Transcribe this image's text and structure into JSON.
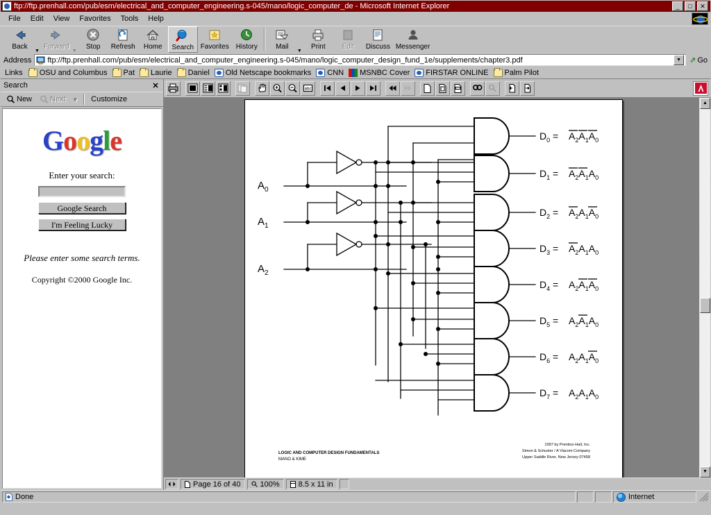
{
  "window": {
    "title": "ftp://ftp.prenhall.com/pub/esm/electrical_and_computer_engineering.s-045/mano/logic_computer_de - Microsoft Internet Explorer",
    "minimize_label": "_",
    "maximize_label": "□",
    "close_label": "✕",
    "app_icon": "ie-document-icon"
  },
  "menu": {
    "items": [
      "File",
      "Edit",
      "View",
      "Favorites",
      "Tools",
      "Help"
    ]
  },
  "toolbar": {
    "buttons": [
      {
        "label": "Back",
        "icon": "back-arrow-icon",
        "disabled": false,
        "dropdown": true,
        "selected": false
      },
      {
        "label": "Forward",
        "icon": "forward-arrow-icon",
        "disabled": true,
        "dropdown": true,
        "selected": false
      },
      {
        "label": "Stop",
        "icon": "stop-icon",
        "disabled": false,
        "dropdown": false,
        "selected": false
      },
      {
        "label": "Refresh",
        "icon": "refresh-icon",
        "disabled": false,
        "dropdown": false,
        "selected": false
      },
      {
        "label": "Home",
        "icon": "home-icon",
        "disabled": false,
        "dropdown": false,
        "selected": false
      },
      {
        "label": "Search",
        "icon": "search-icon",
        "disabled": false,
        "dropdown": false,
        "selected": true
      },
      {
        "label": "Favorites",
        "icon": "favorites-icon",
        "disabled": false,
        "dropdown": false,
        "selected": false
      },
      {
        "label": "History",
        "icon": "history-icon",
        "disabled": false,
        "dropdown": false,
        "selected": false
      },
      {
        "label": "Mail",
        "icon": "mail-icon",
        "disabled": false,
        "dropdown": true,
        "selected": false
      },
      {
        "label": "Print",
        "icon": "print-icon",
        "disabled": false,
        "dropdown": false,
        "selected": false
      },
      {
        "label": "Edit",
        "icon": "edit-icon",
        "disabled": true,
        "dropdown": false,
        "selected": false
      },
      {
        "label": "Discuss",
        "icon": "discuss-icon",
        "disabled": false,
        "dropdown": false,
        "selected": false
      },
      {
        "label": "Messenger",
        "icon": "messenger-icon",
        "disabled": false,
        "dropdown": false,
        "selected": false
      }
    ]
  },
  "address_bar": {
    "label": "Address",
    "value": "ftp://ftp.prenhall.com/pub/esm/electrical_and_computer_engineering.s-045/mano/logic_computer_design_fund_1e/supplements/chapter3.pdf",
    "go_label": "Go",
    "icon": "ftp-page-icon"
  },
  "links_bar": {
    "title": "Links",
    "items": [
      {
        "label": "OSU and Columbus",
        "icon": "folder-icon"
      },
      {
        "label": "Pat",
        "icon": "folder-icon"
      },
      {
        "label": "Laurie",
        "icon": "folder-icon"
      },
      {
        "label": "Daniel",
        "icon": "folder-icon"
      },
      {
        "label": "Old Netscape bookmarks",
        "icon": "ie-icon"
      },
      {
        "label": "CNN",
        "icon": "ie-icon"
      },
      {
        "label": "MSNBC Cover",
        "icon": "msnbc-icon"
      },
      {
        "label": "FIRSTAR ONLINE",
        "icon": "ie-icon"
      },
      {
        "label": "Palm Pilot",
        "icon": "folder-icon"
      }
    ]
  },
  "search_pane": {
    "title": "Search",
    "close_label": "✕",
    "toolbar": [
      {
        "label": "New",
        "icon": "search-new-icon",
        "disabled": false,
        "dropdown": false
      },
      {
        "label": "Next",
        "icon": "search-next-icon",
        "disabled": true,
        "dropdown": true
      },
      {
        "label": "Customize",
        "icon": "none",
        "disabled": false,
        "dropdown": false
      }
    ],
    "google": {
      "logo_letters": [
        "G",
        "o",
        "o",
        "g",
        "l",
        "e"
      ],
      "prompt": "Enter your search:",
      "input_value": "",
      "input_placeholder": "",
      "search_button": "Google Search",
      "lucky_button": "I'm Feeling Lucky",
      "message": "Please enter some search terms.",
      "copyright": "Copyright ©2000 Google Inc."
    }
  },
  "acrobat": {
    "toolbar_groups": [
      {
        "buttons": [
          {
            "icon": "print-pdf-icon"
          }
        ]
      },
      {
        "buttons": [
          {
            "icon": "page-only-view-icon"
          },
          {
            "icon": "bookmarks-view-icon"
          },
          {
            "icon": "thumbnails-view-icon"
          }
        ]
      },
      {
        "buttons": [
          {
            "icon": "copy-icon",
            "disabled": true
          }
        ]
      },
      {
        "buttons": [
          {
            "icon": "hand-tool-icon"
          },
          {
            "icon": "zoom-in-icon"
          },
          {
            "icon": "zoom-out-icon"
          },
          {
            "icon": "text-select-icon"
          }
        ]
      },
      {
        "buttons": [
          {
            "icon": "first-page-icon"
          },
          {
            "icon": "previous-page-icon"
          },
          {
            "icon": "next-page-icon"
          },
          {
            "icon": "last-page-icon"
          }
        ]
      },
      {
        "buttons": [
          {
            "icon": "go-back-view-icon"
          },
          {
            "icon": "go-forward-view-icon",
            "disabled": true
          }
        ]
      },
      {
        "buttons": [
          {
            "icon": "actual-size-icon"
          },
          {
            "icon": "fit-page-icon"
          },
          {
            "icon": "fit-width-icon"
          }
        ]
      },
      {
        "buttons": [
          {
            "icon": "find-icon"
          },
          {
            "icon": "search-pdf-icon",
            "disabled": true
          }
        ]
      },
      {
        "buttons": [
          {
            "icon": "previous-highlight-icon"
          },
          {
            "icon": "next-highlight-icon"
          }
        ]
      }
    ],
    "brand_icon": "adobe-acrobat-icon",
    "status": {
      "nav_icon": "split-view-icon",
      "page_label": "Page 16 of 40",
      "page_icon": "page-icon",
      "zoom_label": "100%",
      "zoom_icon": "magnifier-icon",
      "size_label": "8.5 x 11 in",
      "size_icon": "page-size-icon",
      "resize_label": ""
    }
  },
  "page": {
    "footer_left_line1": "LOGIC AND COMPUTER DESIGN FUNDAMENTALS",
    "footer_left_line2": "MANO & KIME",
    "footer_right_line1": "1997 by Prentice-Hall, Inc.",
    "footer_right_line2": "Simon & Schuster / A Viacom Company",
    "footer_right_line3": "Upper Saddle River, New Jersey 07458"
  },
  "circuit": {
    "inputs": [
      {
        "name": "A0",
        "label_main": "A",
        "label_sub": "0"
      },
      {
        "name": "A1",
        "label_main": "A",
        "label_sub": "1"
      },
      {
        "name": "A2",
        "label_main": "A",
        "label_sub": "2"
      }
    ],
    "inverter_count": 3,
    "gate_type": "AND",
    "gate_count": 8,
    "outputs": [
      {
        "name": "D0",
        "expression": "D₀ = A̅2 A̅1 A̅0",
        "terms": [
          {
            "var": "A",
            "sub": "2",
            "bar": true
          },
          {
            "var": "A",
            "sub": "1",
            "bar": true
          },
          {
            "var": "A",
            "sub": "0",
            "bar": true
          }
        ]
      },
      {
        "name": "D1",
        "expression": "D₁ = A̅2 A̅1 A0",
        "terms": [
          {
            "var": "A",
            "sub": "2",
            "bar": true
          },
          {
            "var": "A",
            "sub": "1",
            "bar": true
          },
          {
            "var": "A",
            "sub": "0",
            "bar": false
          }
        ]
      },
      {
        "name": "D2",
        "expression": "D₂ = A̅2 A1 A̅0",
        "terms": [
          {
            "var": "A",
            "sub": "2",
            "bar": true
          },
          {
            "var": "A",
            "sub": "1",
            "bar": false
          },
          {
            "var": "A",
            "sub": "0",
            "bar": true
          }
        ]
      },
      {
        "name": "D3",
        "expression": "D₃ = A̅2 A1 A0",
        "terms": [
          {
            "var": "A",
            "sub": "2",
            "bar": true
          },
          {
            "var": "A",
            "sub": "1",
            "bar": false
          },
          {
            "var": "A",
            "sub": "0",
            "bar": false
          }
        ]
      },
      {
        "name": "D4",
        "expression": "D₄ = A2 A̅1 A̅0",
        "terms": [
          {
            "var": "A",
            "sub": "2",
            "bar": false
          },
          {
            "var": "A",
            "sub": "1",
            "bar": true
          },
          {
            "var": "A",
            "sub": "0",
            "bar": true
          }
        ]
      },
      {
        "name": "D5",
        "expression": "D₅ = A2 A̅1 A0",
        "terms": [
          {
            "var": "A",
            "sub": "2",
            "bar": false
          },
          {
            "var": "A",
            "sub": "1",
            "bar": true
          },
          {
            "var": "A",
            "sub": "0",
            "bar": false
          }
        ]
      },
      {
        "name": "D6",
        "expression": "D₆ = A2 A1 A̅0",
        "terms": [
          {
            "var": "A",
            "sub": "2",
            "bar": false
          },
          {
            "var": "A",
            "sub": "1",
            "bar": false
          },
          {
            "var": "A",
            "sub": "0",
            "bar": true
          }
        ]
      },
      {
        "name": "D7",
        "expression": "D₇ = A2 A1 A0",
        "terms": [
          {
            "var": "A",
            "sub": "2",
            "bar": false
          },
          {
            "var": "A",
            "sub": "1",
            "bar": false
          },
          {
            "var": "A",
            "sub": "0",
            "bar": false
          }
        ]
      }
    ]
  },
  "status_bar": {
    "message": "Done",
    "message_icon": "ie-page-icon",
    "zone": "Internet",
    "zone_icon": "internet-zone-icon"
  }
}
